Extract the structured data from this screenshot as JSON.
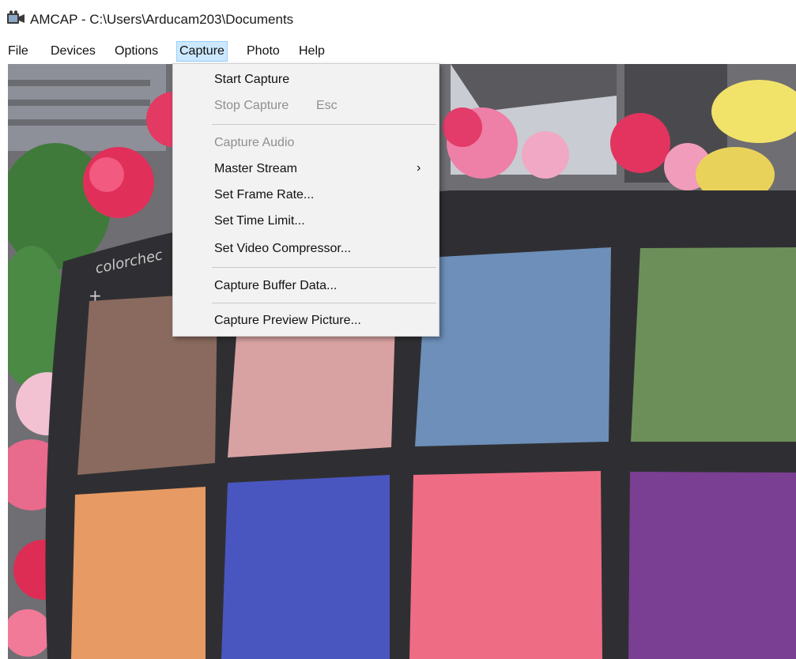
{
  "window": {
    "title": "AMCAP - C:\\Users\\Arducam203\\Documents"
  },
  "menubar": {
    "items": [
      {
        "label": "File"
      },
      {
        "label": "Devices"
      },
      {
        "label": "Options"
      },
      {
        "label": "Capture",
        "active": true
      },
      {
        "label": "Photo"
      },
      {
        "label": "Help"
      }
    ]
  },
  "capture_menu": {
    "start_capture": "Start Capture",
    "stop_capture": "Stop Capture",
    "stop_capture_shortcut": "Esc",
    "capture_audio": "Capture Audio",
    "master_stream": "Master Stream",
    "set_frame_rate": "Set Frame Rate...",
    "set_time_limit": "Set Time Limit...",
    "set_video_compressor": "Set Video Compressor...",
    "capture_buffer_data": "Capture Buffer Data...",
    "capture_preview_picture": "Capture Preview Picture..."
  },
  "preview": {
    "chart_text": "colorchec"
  },
  "colors": {
    "menu_highlight": "#cce8ff",
    "menu_highlight_border": "#99d1ff",
    "disabled_text": "#8f8f8f"
  }
}
